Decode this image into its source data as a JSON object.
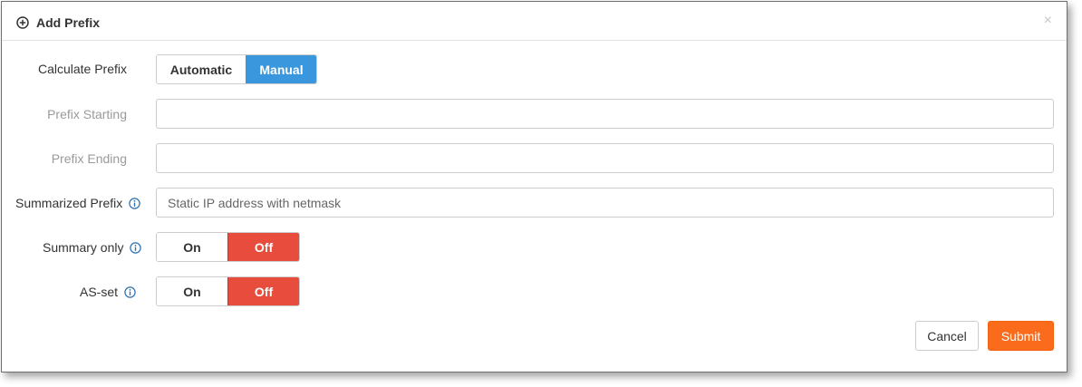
{
  "dialog": {
    "title": "Add Prefix",
    "close_symbol": "×"
  },
  "form": {
    "calculate_prefix": {
      "label": "Calculate Prefix",
      "options": [
        "Automatic",
        "Manual"
      ],
      "selected": "Manual"
    },
    "prefix_starting": {
      "label": "Prefix Starting",
      "value": ""
    },
    "prefix_ending": {
      "label": "Prefix Ending",
      "value": ""
    },
    "summarized_prefix": {
      "label": "Summarized Prefix",
      "placeholder": "Static IP address with netmask"
    },
    "summary_only": {
      "label": "Summary only",
      "on_label": "On",
      "off_label": "Off",
      "selected": "Off"
    },
    "as_set": {
      "label": "AS-set",
      "on_label": "On",
      "off_label": "Off",
      "selected": "Off"
    }
  },
  "buttons": {
    "cancel": "Cancel",
    "submit": "Submit"
  },
  "colors": {
    "accent_blue": "#3a96dd",
    "off_red": "#e74c3c",
    "submit_orange": "#fa6b1c"
  },
  "icons": {
    "title_icon": "plus-circle-icon",
    "info_icon": "info-icon"
  }
}
